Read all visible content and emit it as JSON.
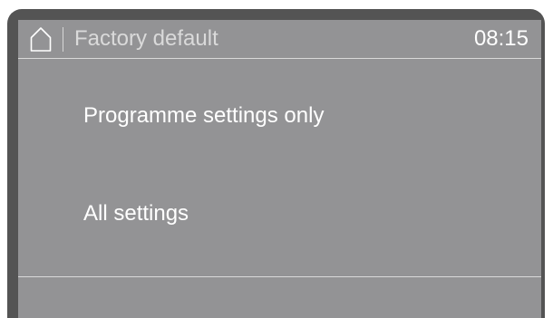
{
  "header": {
    "home_icon": "home-icon",
    "title": "Factory default",
    "time": "08:15"
  },
  "options": [
    {
      "label": "Programme settings only"
    },
    {
      "label": "All settings"
    }
  ],
  "colors": {
    "screen_background": "#939395",
    "bezel": "#545454",
    "text": "#ffffff",
    "title_text": "#dadada"
  }
}
